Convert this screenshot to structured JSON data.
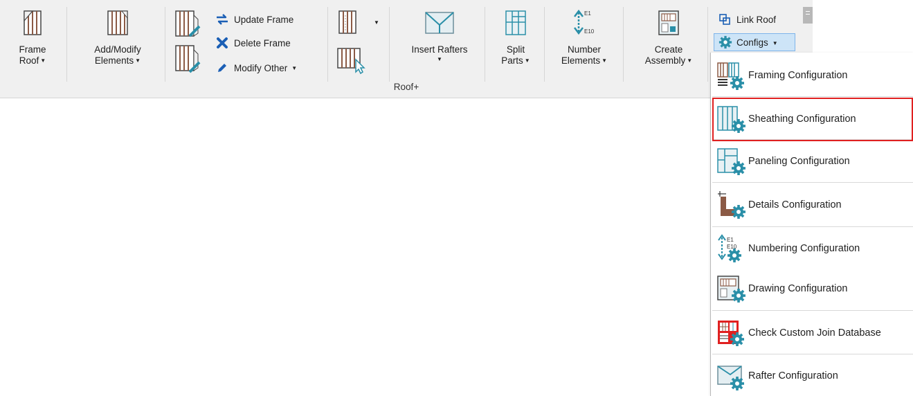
{
  "ribbon": {
    "panel_title": "Roof+",
    "frame_roof_label": "Frame\nRoof",
    "add_modify_label": "Add/Modify\nElements",
    "update_frame_label": "Update Frame",
    "delete_frame_label": "Delete Frame",
    "modify_other_label": "Modify Other",
    "insert_rafters_label": "Insert Rafters",
    "split_parts_label": "Split\nParts",
    "number_elements_label": "Number\nElements",
    "create_assembly_label": "Create\nAssembly",
    "link_roof_label": "Link Roof",
    "configs_label": "Configs",
    "number_icon_top": "E1",
    "number_icon_bottom": "E10"
  },
  "menu": {
    "items": [
      {
        "label": "Framing Configuration",
        "icon": "framing-config-icon"
      },
      {
        "label": "Sheathing Configuration",
        "icon": "sheathing-config-icon",
        "highlighted": true
      },
      {
        "label": "Paneling Configuration",
        "icon": "paneling-config-icon"
      },
      {
        "label": "Details Configuration",
        "icon": "details-config-icon"
      },
      {
        "label": "Numbering Configuration",
        "icon": "numbering-config-icon"
      },
      {
        "label": "Drawing Configuration",
        "icon": "drawing-config-icon"
      },
      {
        "label": "Check Custom Join Database",
        "icon": "join-database-icon"
      },
      {
        "label": "Rafter Configuration",
        "icon": "rafter-config-icon"
      }
    ]
  },
  "colors": {
    "highlight_border": "#e02020",
    "configs_active_bg": "#cde4f7",
    "icon_teal": "#2a8fa8",
    "icon_brown": "#8b5a45"
  }
}
